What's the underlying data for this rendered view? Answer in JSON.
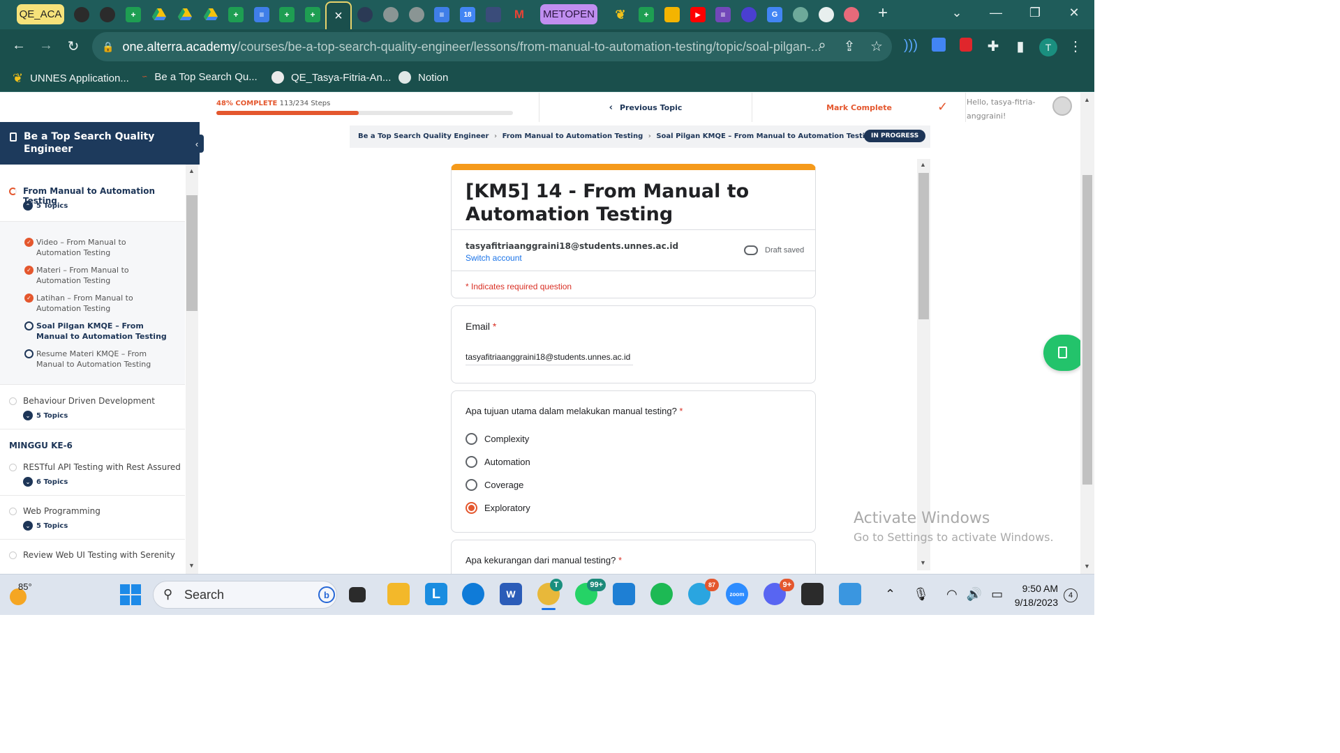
{
  "browser": {
    "tabs": {
      "group_label_1": "QE_ACA",
      "group_label_2": "METOPEN",
      "active_close": "×",
      "new_tab": "+"
    },
    "url_host": "one.alterra.academy",
    "url_path": "/courses/be-a-top-search-quality-engineer/lessons/from-manual-to-automation-testing/topic/soal-pilgan-...",
    "profile_initial": "T",
    "bookmarks": [
      {
        "label": "UNNES Application..."
      },
      {
        "label": "Be a Top Search Qu..."
      },
      {
        "label": "QE_Tasya-Fitria-An..."
      },
      {
        "label": "Notion"
      }
    ]
  },
  "course_header": {
    "progress_percent_label": "48% COMPLETE",
    "progress_steps": "113/234 Steps",
    "progress_fraction": 0.48,
    "previous_topic": "Previous Topic",
    "mark_complete": "Mark Complete",
    "hello": "Hello, tasya-fitria-anggraini!"
  },
  "sidebar": {
    "course_title": "Be a Top Search Quality Engineer",
    "current_lesson": "From Manual to Automation Testing",
    "current_lesson_topics": "5 Topics",
    "topics": [
      {
        "label": "Video – From Manual to Automation Testing",
        "status": "done"
      },
      {
        "label": "Materi – From Manual to Automation Testing",
        "status": "done"
      },
      {
        "label": "Latihan – From Manual to Automation Testing",
        "status": "done"
      },
      {
        "label": "Soal Pilgan KMQE – From Manual to Automation Testing",
        "status": "current"
      },
      {
        "label": "Resume Materi KMQE – From Manual to Automation Testing",
        "status": "open"
      }
    ],
    "lessons_after": [
      {
        "label": "Behaviour Driven Development",
        "topics": "5 Topics"
      }
    ],
    "week_label": "MINGGU KE-6",
    "week_lessons": [
      {
        "label": "RESTful API Testing with Rest Assured",
        "topics": "6 Topics"
      },
      {
        "label": "Web Programming",
        "topics": "5 Topics"
      },
      {
        "label": "Review Web UI Testing with Serenity",
        "topics": ""
      }
    ]
  },
  "breadcrumb": {
    "items": [
      "Be a Top Search Quality Engineer",
      "From Manual to Automation Testing",
      "Soal Pilgan KMQE – From Manual to Automation Testing"
    ],
    "separator": "›",
    "status": "IN PROGRESS"
  },
  "form": {
    "title": "[KM5] 14 - From Manual to Automation Testing",
    "account_email": "tasyafitriaanggraini18@students.unnes.ac.id",
    "switch_account": "Switch account",
    "draft_status": "Draft saved",
    "required_note": "* Indicates required question",
    "email_question": "Email",
    "email_value": "tasyafitriaanggraini18@students.unnes.ac.id",
    "required_marker": "*",
    "q1": {
      "title": "Apa tujuan utama dalam melakukan manual testing?",
      "options": [
        "Complexity",
        "Automation",
        "Coverage",
        "Exploratory"
      ],
      "selected_index": 3
    },
    "q2": {
      "title": "Apa kekurangan dari manual testing?"
    }
  },
  "watermark": {
    "line1": "Activate Windows",
    "line2": "Go to Settings to activate Windows."
  },
  "taskbar": {
    "temperature": "85°",
    "search_label": "Search",
    "whatsapp_badge": "99+",
    "telegram_badge": "87",
    "discord_badge": "9+",
    "time": "9:50 AM",
    "date": "9/18/2023",
    "notification_count": "4"
  },
  "colors": {
    "chrome_frame": "#1f5c5a",
    "accent_orange": "#e4572e",
    "navy": "#1d3557",
    "form_header_bar": "#f59a1b",
    "float_button": "#23c36b"
  }
}
